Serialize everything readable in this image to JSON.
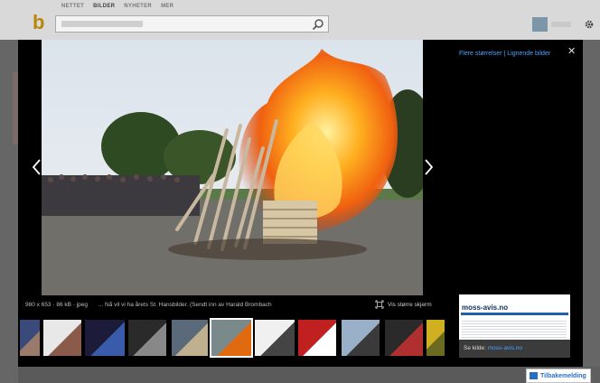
{
  "header": {
    "logo": "b",
    "nav": [
      "NETTET",
      "BILDER",
      "NYHETER",
      "MER"
    ],
    "active_nav": "BILDER"
  },
  "viewer": {
    "links": {
      "more_sizes": "Flere størrelser",
      "separator": "|",
      "similar": "Lignende bilder"
    },
    "caption": {
      "meta": "980 x 653 · 86 kB · jpeg",
      "text": "... Nå vil vi ha årets St. Hansbilder. (Sendt inn av Harald Brombach"
    },
    "larger_label": "Vis større skjerm",
    "source": {
      "thumb_title": "moss-avis.no",
      "prefix": "Se kilde:",
      "link": "moss-avis.no"
    },
    "thumbnails": [
      {
        "name": "thumb-1",
        "colors": [
          "#3a4a7a",
          "#9a7a6a"
        ]
      },
      {
        "name": "thumb-2",
        "colors": [
          "#e8e8e8",
          "#8a5a4a"
        ]
      },
      {
        "name": "thumb-3",
        "colors": [
          "#1c1c3a",
          "#3a5aaa"
        ]
      },
      {
        "name": "thumb-4",
        "colors": [
          "#2a2a2a",
          "#888888"
        ]
      },
      {
        "name": "thumb-5",
        "colors": [
          "#5a6a7a",
          "#c0b090"
        ]
      },
      {
        "name": "thumb-6",
        "colors": [
          "#7a8a8a",
          "#e06a10"
        ]
      },
      {
        "name": "thumb-7",
        "colors": [
          "#f0f0f0",
          "#444444"
        ]
      },
      {
        "name": "thumb-8",
        "colors": [
          "#c02020",
          "#ffffff"
        ]
      },
      {
        "name": "thumb-9",
        "colors": [
          "#9ab0c8",
          "#3a3a3a"
        ]
      },
      {
        "name": "thumb-10",
        "colors": [
          "#2a2a2a",
          "#b03030"
        ]
      },
      {
        "name": "thumb-11",
        "colors": [
          "#d0b020",
          "#6a6a20"
        ]
      }
    ]
  },
  "feedback_label": "Tilbakemelding",
  "colors": {
    "link": "#4aa3ff",
    "fire": "#f07010",
    "overlay": "#000000"
  }
}
